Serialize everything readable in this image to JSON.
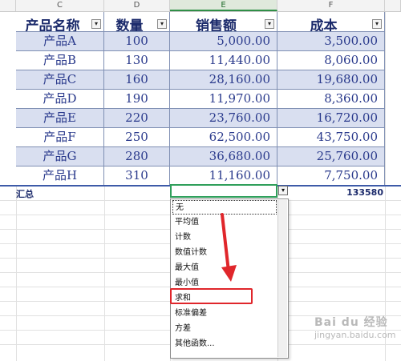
{
  "column_letters": [
    "C",
    "D",
    "E",
    "F"
  ],
  "table": {
    "headers": [
      "产品名称",
      "数量",
      "销售额",
      "成本"
    ],
    "filter_glyph": "▾",
    "rows": [
      [
        "产品A",
        "100",
        "5,000.00",
        "3,500.00"
      ],
      [
        "产品B",
        "130",
        "11,440.00",
        "8,060.00"
      ],
      [
        "产品C",
        "160",
        "28,160.00",
        "19,680.00"
      ],
      [
        "产品D",
        "190",
        "11,970.00",
        "8,360.00"
      ],
      [
        "产品E",
        "220",
        "23,760.00",
        "16,720.00"
      ],
      [
        "产品F",
        "250",
        "62,500.00",
        "43,750.00"
      ],
      [
        "产品G",
        "280",
        "36,680.00",
        "25,760.00"
      ],
      [
        "产品H",
        "310",
        "11,160.00",
        "7,750.00"
      ]
    ]
  },
  "total_row": {
    "label": "汇总",
    "cost_total": "133580",
    "dropdown_glyph": "▾"
  },
  "dropdown_menu": {
    "items": [
      "无",
      "平均值",
      "计数",
      "数值计数",
      "最大值",
      "最小值",
      "求和",
      "标准偏差",
      "方差",
      "其他函数..."
    ],
    "selected_index": 0,
    "highlighted_item": "求和"
  },
  "colors": {
    "header_text": "#1b2a6b",
    "stripe": "#d9dff0",
    "active_cell_border": "#2f9f5b",
    "annotation_red": "#e0262b"
  },
  "watermark": {
    "logo": "Bai du 经验",
    "url": "jingyan.baidu.com"
  }
}
